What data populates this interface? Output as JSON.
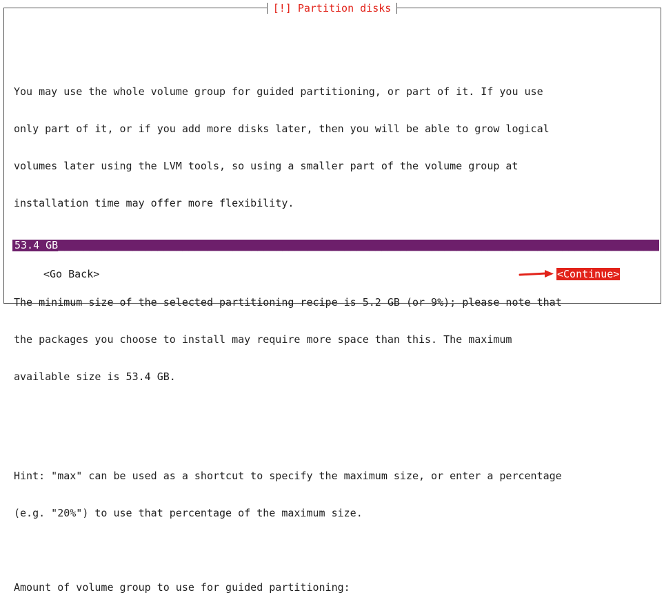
{
  "dialog": {
    "title": "[!] Partition disks"
  },
  "content": {
    "paragraph_1": [
      "You may use the whole volume group for guided partitioning, or part of it. If you use",
      "only part of it, or if you add more disks later, then you will be able to grow logical",
      "volumes later using the LVM tools, so using a smaller part of the volume group at",
      "installation time may offer more flexibility."
    ],
    "paragraph_2": [
      "The minimum size of the selected partitioning recipe is 5.2 GB (or 9%); please note that",
      "the packages you choose to install may require more space than this. The maximum",
      "available size is 53.4 GB."
    ],
    "paragraph_3": [
      "Hint: \"max\" can be used as a shortcut to specify the maximum size, or enter a percentage",
      "(e.g. \"20%\") to use that percentage of the maximum size."
    ],
    "prompt": "Amount of volume group to use for guided partitioning:"
  },
  "input": {
    "value": "53.4 GB",
    "fill": "__________________________________________________________________________________________________________________"
  },
  "buttons": {
    "back": "<Go Back>",
    "continue": "<Continue>"
  },
  "colors": {
    "title": "#e2231a",
    "input_bg": "#6d1f6b",
    "continue_bg": "#e2231a",
    "arrow": "#e2231a"
  }
}
